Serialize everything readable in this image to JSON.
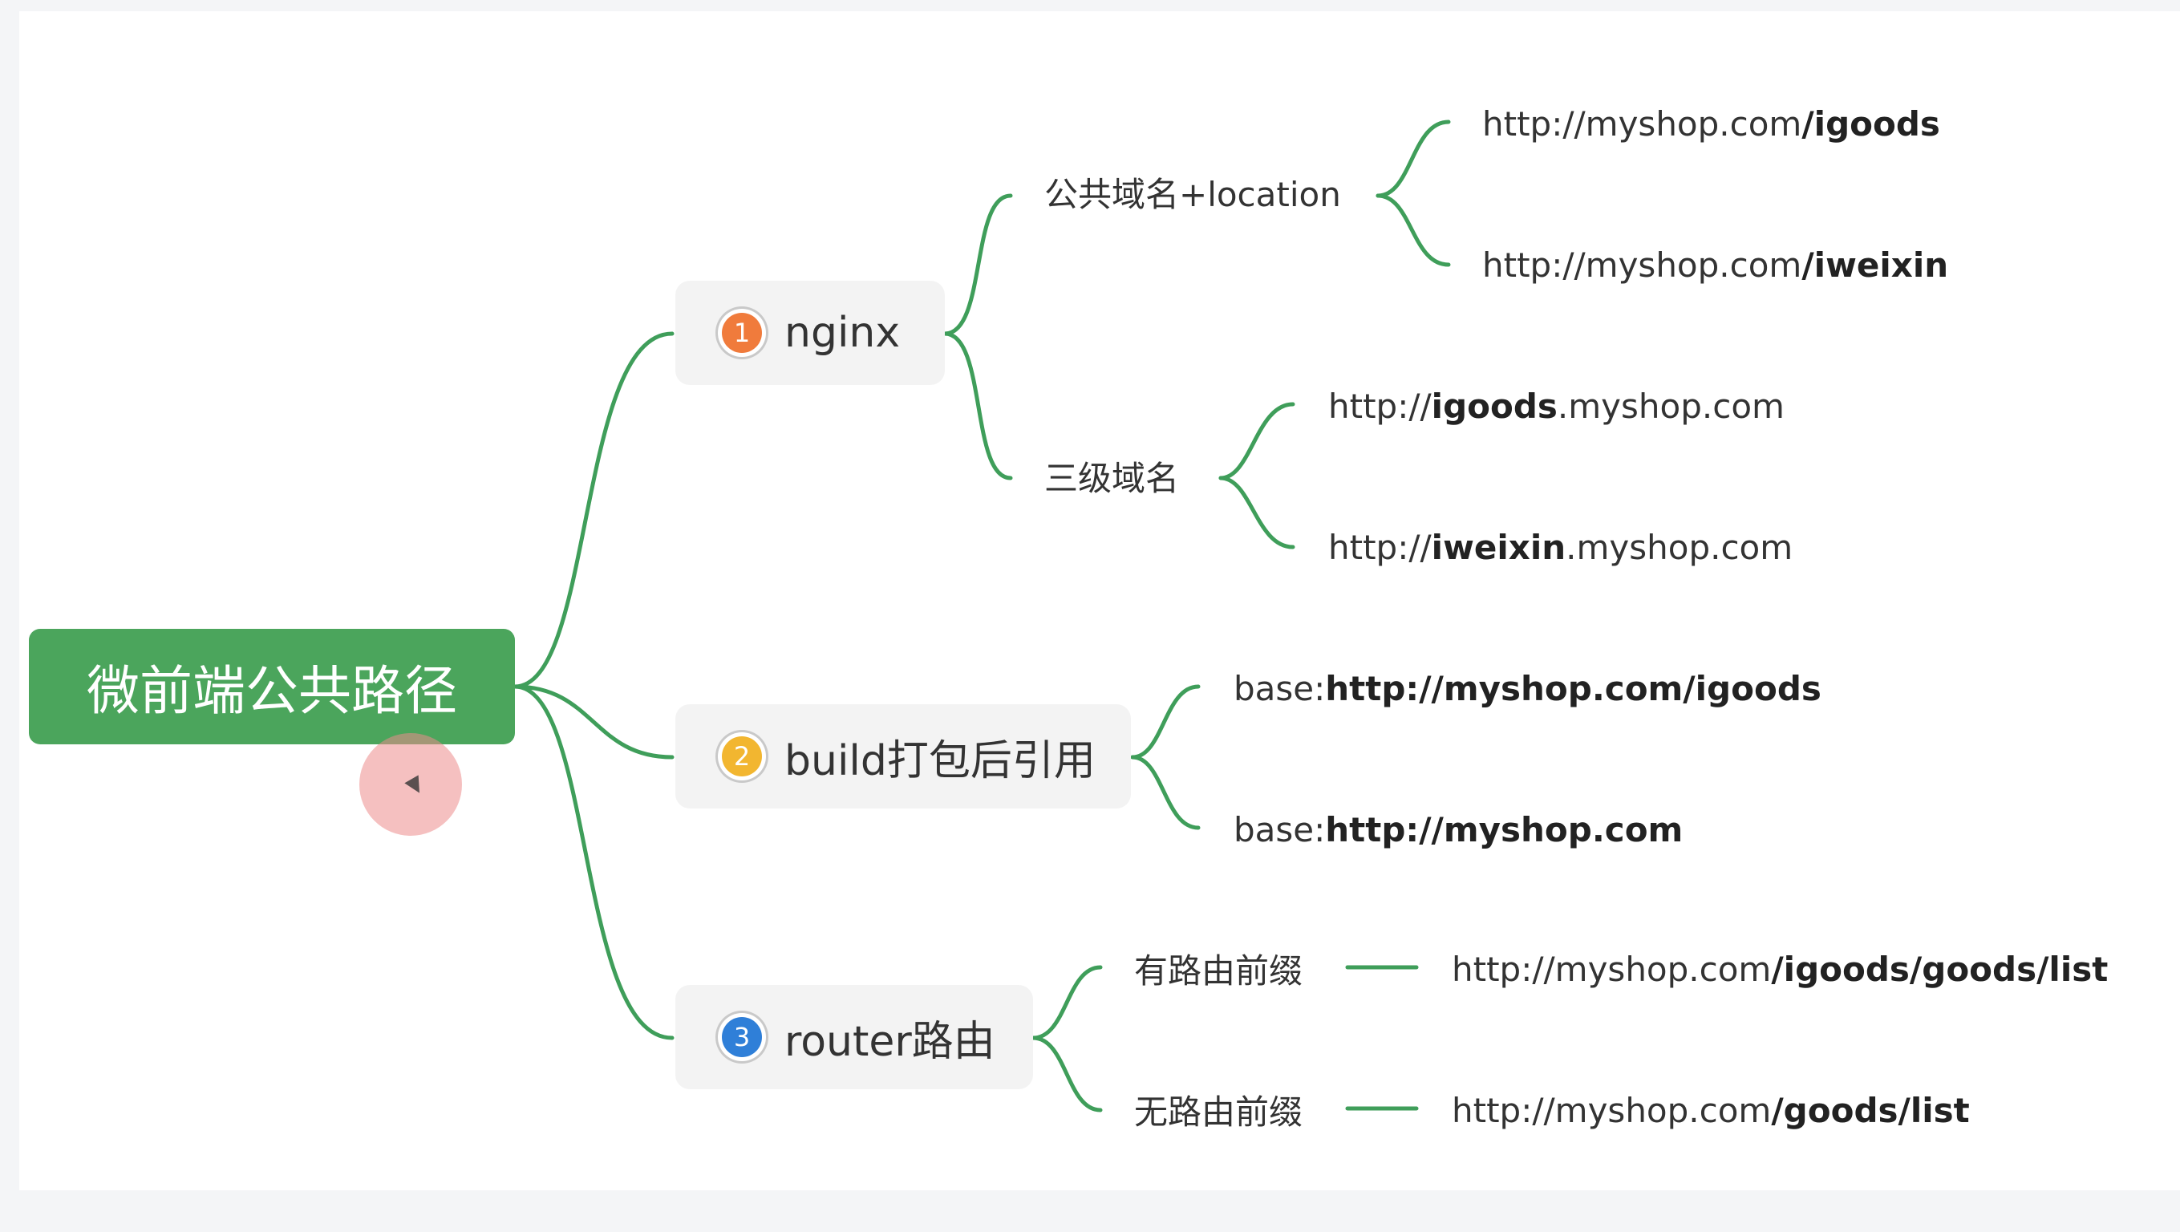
{
  "root": {
    "label": "微前端公共路径",
    "color": "#4ba55c"
  },
  "branches": [
    {
      "index": "1",
      "label": "nginx",
      "badge_color": "#f07b3c",
      "groups": [
        {
          "label": "公共域名+location",
          "leaves": [
            {
              "prefix": "http://myshop.com",
              "bold": "/igoods",
              "suffix": ""
            },
            {
              "prefix": "http://myshop.com",
              "bold": "/iweixin",
              "suffix": ""
            }
          ]
        },
        {
          "label": "三级域名",
          "leaves": [
            {
              "prefix": "http://",
              "bold": "igoods",
              "suffix": ".myshop.com"
            },
            {
              "prefix": "http://",
              "bold": "iweixin",
              "suffix": ".myshop.com"
            }
          ]
        }
      ]
    },
    {
      "index": "2",
      "label": "build打包后引用",
      "badge_color": "#f2b630",
      "leaves": [
        {
          "prefix": "base:",
          "bold": "http://myshop.com/igoods",
          "suffix": ""
        },
        {
          "prefix": "base:",
          "bold": "http://myshop.com",
          "suffix": ""
        }
      ]
    },
    {
      "index": "3",
      "label": "router路由",
      "badge_color": "#2f7fd8",
      "groups": [
        {
          "label": "有路由前缀",
          "leaf": {
            "prefix": "http://myshop.com",
            "bold": "/igoods/goods/list",
            "suffix": ""
          }
        },
        {
          "label": "无路由前缀",
          "leaf": {
            "prefix": "http://myshop.com",
            "bold": "/goods/list",
            "suffix": ""
          }
        }
      ]
    }
  ],
  "line_color": "#3f9e5a"
}
